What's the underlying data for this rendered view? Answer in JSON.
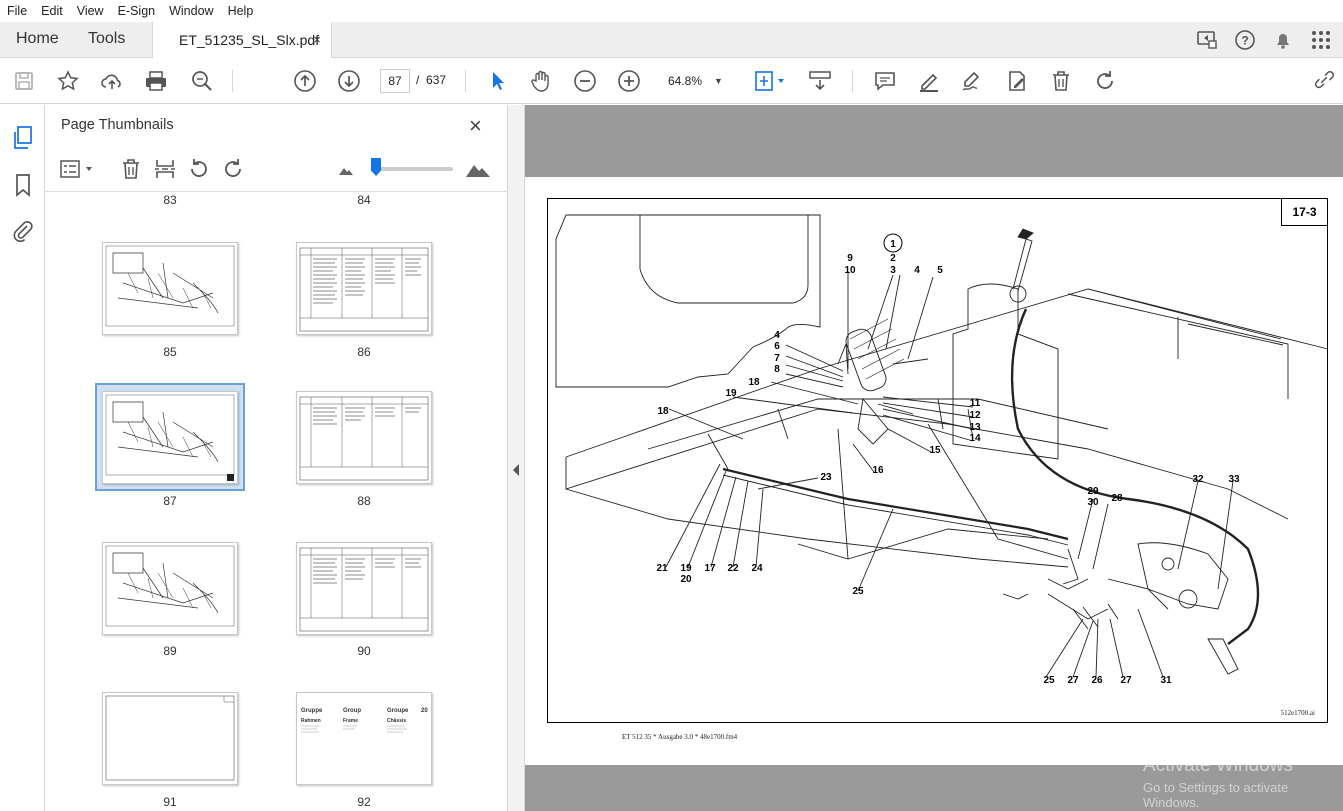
{
  "menu": [
    "File",
    "Edit",
    "View",
    "E-Sign",
    "Window",
    "Help"
  ],
  "tabs": {
    "home": "Home",
    "tools": "Tools",
    "document": "ET_51235_SL_Slx.pdf",
    "close": "×"
  },
  "toolbar": {
    "current_page": "87",
    "separator": "/",
    "total_pages": "637",
    "zoom": "64.8%"
  },
  "panel": {
    "title": "Page Thumbnails",
    "close": "×"
  },
  "thumbnails": [
    {
      "label": "83"
    },
    {
      "label": "84"
    },
    {
      "label": "85"
    },
    {
      "label": "86"
    },
    {
      "label": "87"
    },
    {
      "label": "88"
    },
    {
      "label": "89"
    },
    {
      "label": "90"
    },
    {
      "label": "91"
    },
    {
      "label": "92"
    }
  ],
  "thumb92": {
    "col1": "Gruppe",
    "col2": "Group",
    "col3": "Groupe",
    "num": "20",
    "r1": "Rahmen",
    "r2": "Frame",
    "r3": "Châssis"
  },
  "document": {
    "page_code": "17-3",
    "file_name": "512e1700.ai",
    "footer": "ET 512 35 * Ausgabe 3.0 * 48e1700.fm4",
    "callouts": {
      "c1": "1",
      "c2": "2",
      "c3": "3",
      "c4a": "4",
      "c5": "5",
      "c9": "9",
      "c10": "10",
      "c4b": "4",
      "c6": "6",
      "c7": "7",
      "c8": "8",
      "c18a": "18",
      "c19a": "19",
      "c18b": "18",
      "c11": "11",
      "c12": "12",
      "c13": "13",
      "c14": "14",
      "c15": "15",
      "c16": "16",
      "c23": "23",
      "c21": "21",
      "c19b": "19",
      "c20": "20",
      "c17": "17",
      "c22": "22",
      "c24": "24",
      "c25a": "25",
      "c29": "29",
      "c30": "30",
      "c28": "28",
      "c32": "32",
      "c33": "33",
      "c25b": "25",
      "c27a": "27",
      "c26": "26",
      "c27b": "27",
      "c31": "31"
    }
  },
  "watermark": {
    "line1": "Activate Windows",
    "line2": "Go to Settings to activate Windows."
  },
  "colors": {
    "accent": "#1473e6",
    "viewer_bg": "#9a9a9a",
    "selection": "#cfe0f3"
  }
}
